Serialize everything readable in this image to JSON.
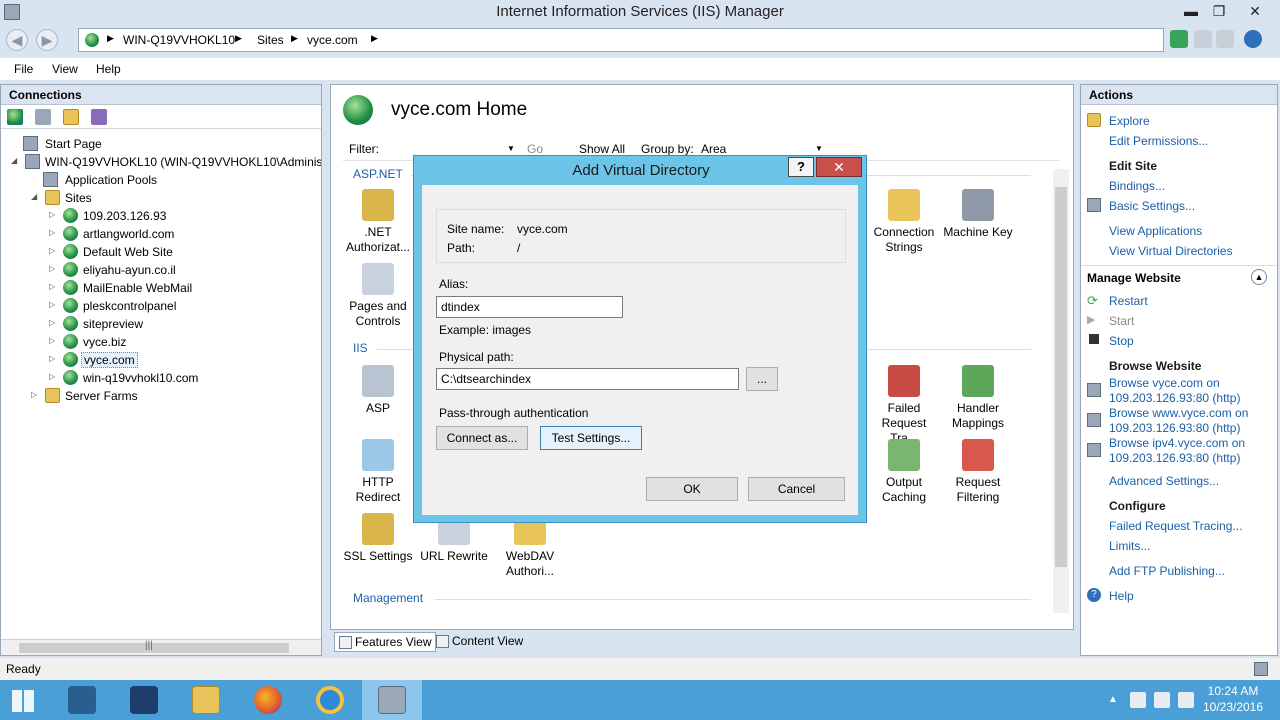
{
  "window": {
    "title": "Internet Information Services (IIS) Manager",
    "minimize": "▬",
    "maximize": "❐",
    "close": "✕"
  },
  "address": {
    "crumbs": [
      "WIN-Q19VVHOKL10",
      "Sites",
      "vyce.com"
    ],
    "sep": "▶"
  },
  "menu": [
    "File",
    "View",
    "Help"
  ],
  "connections": {
    "title": "Connections",
    "tree": [
      "Start Page",
      "WIN-Q19VVHOKL10 (WIN-Q19VVHOKL10\\Administr",
      "Application Pools",
      "Sites",
      "109.203.126.93",
      "artlangworld.com",
      "Default Web Site",
      "eliyahu-ayun.co.il",
      "MailEnable WebMail",
      "pleskcontrolpanel",
      "sitepreview",
      "vyce.biz",
      "vyce.com",
      "win-q19vvhokl10.com",
      "Server Farms"
    ],
    "scroll_glyph": "|||"
  },
  "center": {
    "home_title": "vyce.com Home",
    "filter_label": "Filter:",
    "go_label": "Go",
    "show_all_label": "Show All",
    "group_by_label": "Group by:",
    "group_by_value": "Area",
    "sections": [
      "ASP.NET",
      "IIS",
      "Management"
    ],
    "features": [
      ".NET\nAuthorizat...",
      "Pages and\nControls",
      "Connection\nStrings",
      "Machine Key",
      "ASP",
      "HTTP\nRedirect",
      "Failed\nRequest Tra...",
      "Handler\nMappings",
      "Output\nCaching",
      "Request\nFiltering",
      "SSL Settings",
      "URL Rewrite",
      "WebDAV\nAuthori..."
    ],
    "tabs": [
      "Features View",
      "Content View"
    ]
  },
  "actions": {
    "title": "Actions",
    "explore": "Explore",
    "edit_permissions": "Edit Permissions...",
    "edit_site": "Edit Site",
    "bindings": "Bindings...",
    "basic_settings": "Basic Settings...",
    "view_applications": "View Applications",
    "view_virtual_directories": "View Virtual Directories",
    "manage_website": "Manage Website",
    "restart": "Restart",
    "start": "Start",
    "stop": "Stop",
    "browse_website": "Browse Website",
    "browse1": [
      "Browse vyce.com on",
      "109.203.126.93:80 (http)"
    ],
    "browse2": [
      "Browse www.vyce.com on",
      "109.203.126.93:80 (http)"
    ],
    "browse3": [
      "Browse ipv4.vyce.com on",
      "109.203.126.93:80 (http)"
    ],
    "advanced_settings": "Advanced Settings...",
    "configure": "Configure",
    "failed_request_tracing": "Failed Request Tracing...",
    "limits": "Limits...",
    "add_ftp": "Add FTP Publishing...",
    "help": "Help"
  },
  "status": {
    "text": "Ready"
  },
  "taskbar": {
    "time": "10:24 AM",
    "date": "10/23/2016"
  },
  "dialog": {
    "title": "Add Virtual Directory",
    "help": "?",
    "close": "✕",
    "site_name_label": "Site name:",
    "site_name_value": "vyce.com",
    "path_label": "Path:",
    "path_value": "/",
    "alias_label": "Alias:",
    "alias_value": "dtindex",
    "example": "Example: images",
    "physical_path_label": "Physical path:",
    "physical_path_value": "C:\\dtsearchindex",
    "browse_label": "...",
    "passthrough_label": "Pass-through authentication",
    "connect_as": "Connect as...",
    "test_settings": "Test Settings...",
    "ok": "OK",
    "cancel": "Cancel"
  },
  "colors": {
    "accent": "#1b5fa8",
    "taskbar": "#4a9fd6",
    "dialog_frame": "#6cc4e8",
    "close_red": "#c7504a"
  }
}
